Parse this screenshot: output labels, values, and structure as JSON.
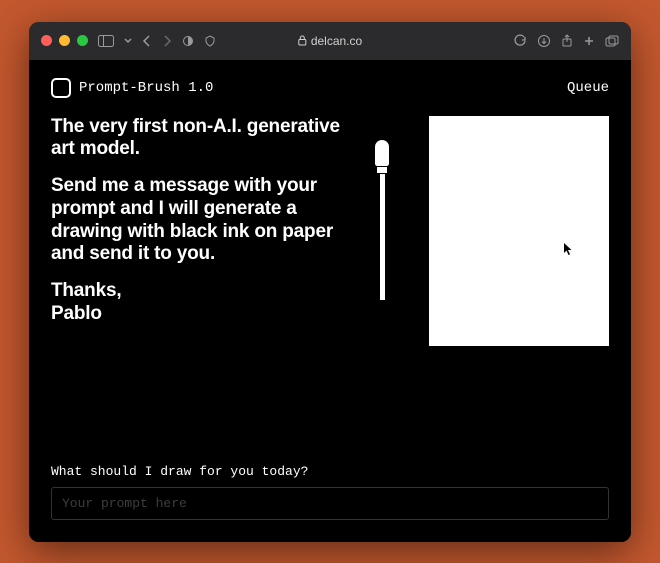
{
  "browser": {
    "domain": "delcan.co"
  },
  "header": {
    "brand": "Prompt-Brush 1.0",
    "queue_label": "Queue"
  },
  "hero": {
    "line1": "The very first non-A.I. generative art model.",
    "line2": "Send me a message with your prompt and I will generate a drawing with black ink on paper and send it to you.",
    "thanks": "Thanks,",
    "signature": "Pablo"
  },
  "prompt": {
    "label": "What should I draw for you today?",
    "placeholder": "Your prompt here",
    "value": ""
  },
  "colors": {
    "page_bg": "#C4582E",
    "app_bg": "#000000",
    "text": "#FFFFFF"
  }
}
